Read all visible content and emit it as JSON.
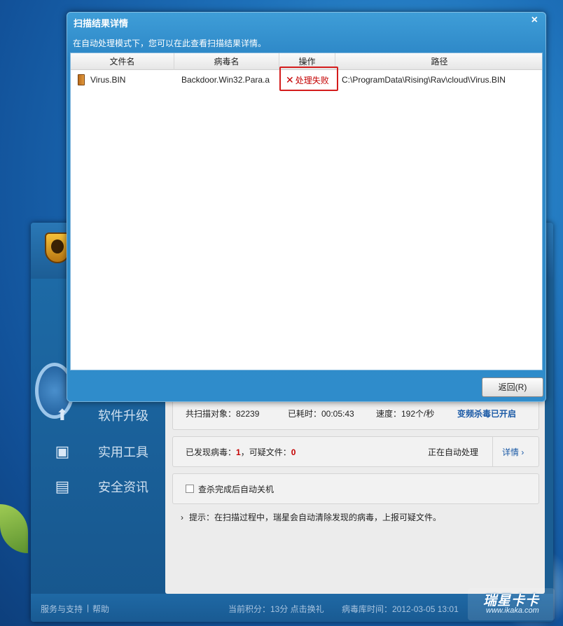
{
  "dialog": {
    "title": "扫描结果详情",
    "close_icon": "×",
    "subtitle": "在自动处理模式下，您可以在此查看扫描结果详情。",
    "columns": [
      "文件名",
      "病毒名",
      "操作",
      "路径"
    ],
    "rows": [
      {
        "file": "Virus.BIN",
        "virus": "Backdoor.Win32.Para.a",
        "action": "处理失败",
        "path": "C:\\ProgramData\\Rising\\Rav\\cloud\\Virus.BIN"
      }
    ],
    "return_button": "返回(R)"
  },
  "app": {
    "nav": [
      {
        "label": "软件升级",
        "icon": "up-arrow-icon"
      },
      {
        "label": "实用工具",
        "icon": "toolbox-icon"
      },
      {
        "label": "安全资讯",
        "icon": "document-icon"
      }
    ],
    "stats": {
      "scanned_label": "共扫描对象：82239",
      "elapsed_label": "已耗时：00:05:43",
      "speed_label": "速度：192个/秒",
      "video_kill": "变频杀毒已开启"
    },
    "found": {
      "prefix": "已发现病毒：",
      "virus_count": "1",
      "middle": "，可疑文件：",
      "suspicious_count": "0",
      "status": "正在自动处理",
      "details_link": "详情 ›"
    },
    "auto_shutdown_label": "查杀完成后自动关机",
    "tip": "提示：在扫描过程中，瑞星会自动清除发现的病毒，上报可疑文件。",
    "footer": {
      "support": "服务与支持",
      "help": "帮助",
      "points": "当前积分：13分 点击换礼",
      "db_time": "病毒库时间：2012-03-05 13:01"
    }
  },
  "watermark": {
    "brand": "瑞星卡卡",
    "url": "www.ikaka.com"
  }
}
